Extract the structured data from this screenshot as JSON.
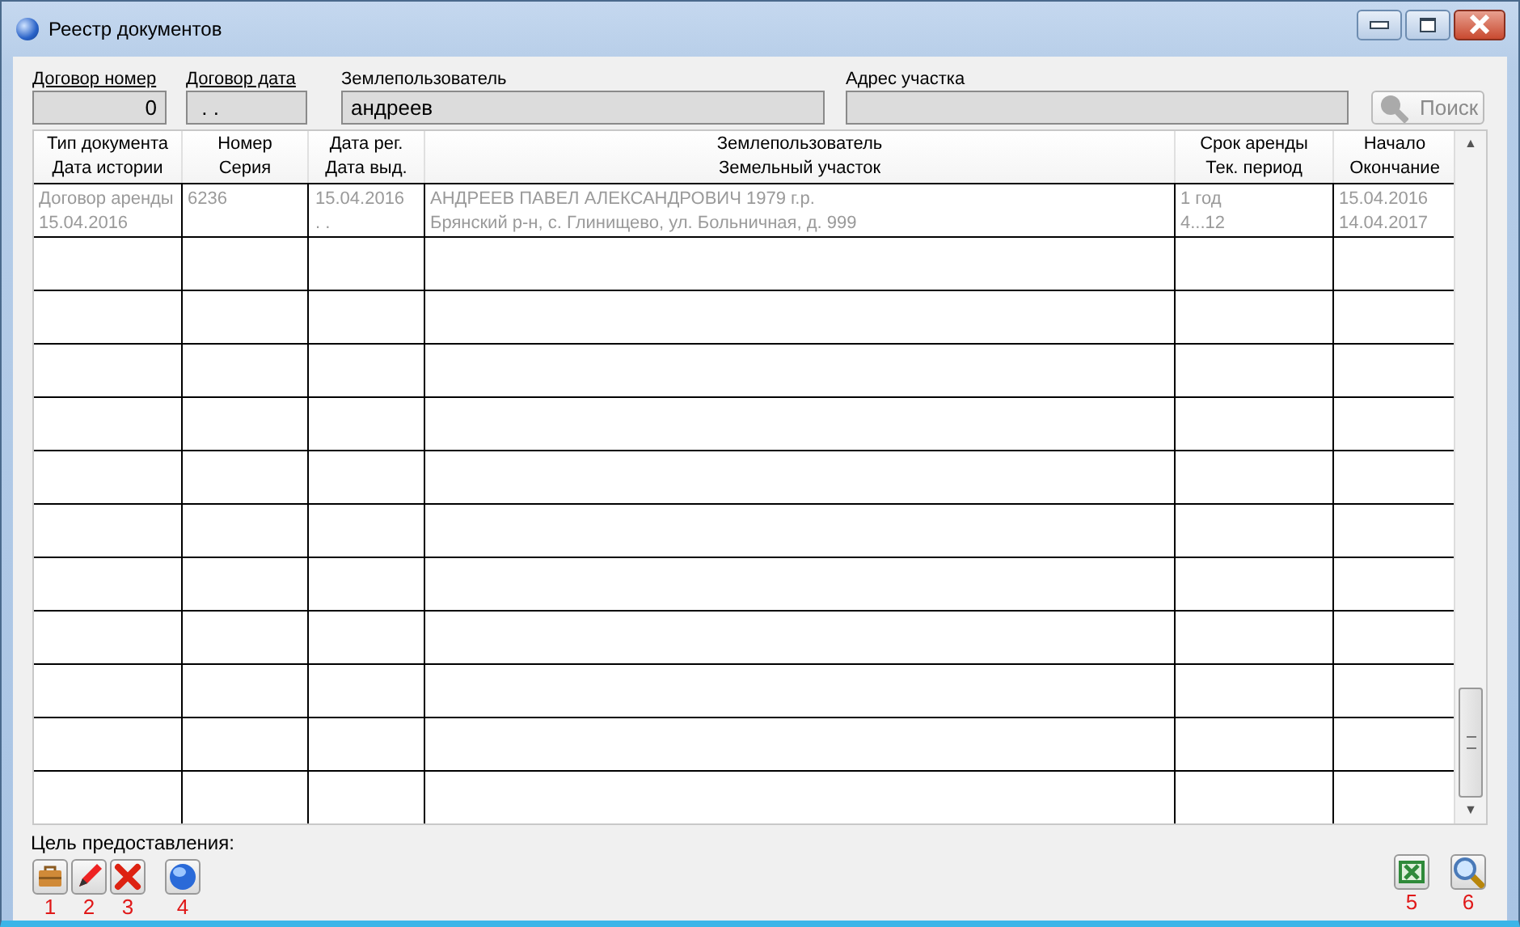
{
  "window": {
    "title": "Реестр документов"
  },
  "filters": [
    {
      "label": "Договор номер",
      "value": "0"
    },
    {
      "label": "Договор дата",
      "value": " . ."
    },
    {
      "label": "Землепользователь",
      "value": "андреев"
    },
    {
      "label": "Адрес участка"
    }
  ],
  "scroll_arrows": [
    "▲",
    "▼"
  ],
  "search_button": {
    "label": "Поиск",
    "disabled": true
  },
  "table": {
    "columns": [
      {
        "lines": [
          "Тип документа",
          "Дата истории"
        ]
      },
      {
        "lines": [
          "Номер",
          "Серия"
        ]
      },
      {
        "lines": [
          "Дата рег.",
          "Дата выд."
        ]
      },
      {
        "lines": [
          "Землепользователь",
          "Земельный участок"
        ]
      },
      {
        "lines": [
          "Срок аренды",
          "Тек. период"
        ]
      },
      {
        "lines": [
          "Начало",
          "Окончание"
        ]
      }
    ],
    "rows": [
      {
        "cells": [
          [
            "Договор аренды",
            "15.04.2016"
          ],
          [
            "6236"
          ],
          [
            "15.04.2016",
            " . ."
          ],
          [
            "АНДРЕЕВ ПАВЕЛ АЛЕКСАНДРОВИЧ 1979 г.р.",
            "Брянский р-н, с. Глинищево, ул. Больничная, д. 999"
          ],
          [
            "1 год",
            "4...12"
          ],
          [
            "15.04.2016",
            "14.04.2017"
          ]
        ]
      }
    ]
  },
  "purpose_label": "Цель предоставления:",
  "left_tools": [
    {
      "kind": "briefcase",
      "annotation": "1"
    },
    {
      "kind": "pencil",
      "annotation": "2"
    },
    {
      "kind": "delete",
      "annotation": "3"
    },
    {
      "kind": "globe",
      "annotation": "4"
    }
  ],
  "right_tools": [
    {
      "kind": "excel",
      "annotation": "5"
    },
    {
      "kind": "magnifier",
      "annotation": "6"
    }
  ]
}
